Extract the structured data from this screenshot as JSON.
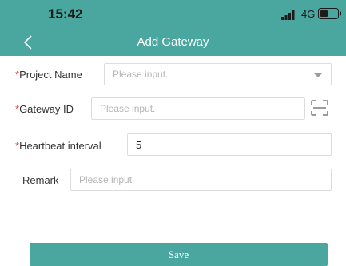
{
  "status_bar": {
    "time": "15:42",
    "network": "4G",
    "icons": [
      "signal-icon",
      "battery-icon"
    ]
  },
  "nav": {
    "title": "Add Gateway",
    "back_icon": "chevron-left-icon"
  },
  "form": {
    "required_marker": "*",
    "project_name": {
      "label": "Project Name",
      "placeholder": "Please input.",
      "value": ""
    },
    "gateway_id": {
      "label": "Gateway ID",
      "placeholder": "Please input.",
      "value": "",
      "scan_icon": "scan-icon"
    },
    "heartbeat_interval": {
      "label": "Heartbeat interval",
      "value": "5"
    },
    "remark": {
      "label": "Remark",
      "placeholder": "Please input.",
      "value": ""
    }
  },
  "actions": {
    "save_label": "Save"
  },
  "colors": {
    "accent": "#4aa79f",
    "required": "#e0453a",
    "placeholder": "#b5b5b5"
  }
}
